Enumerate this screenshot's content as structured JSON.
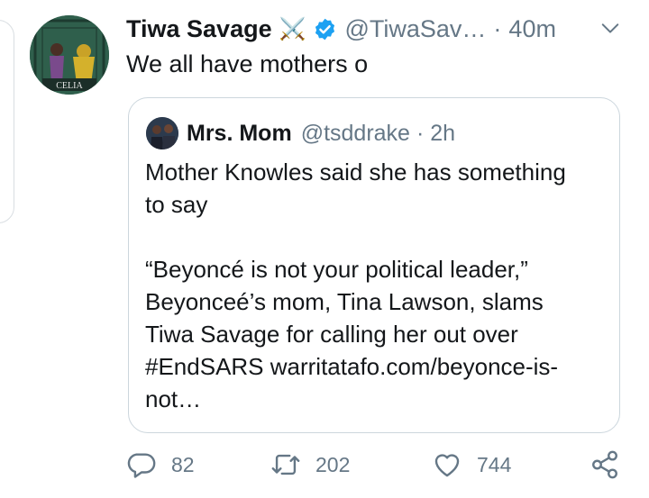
{
  "tweet": {
    "author_name": "Tiwa Savage",
    "author_emoji": "⚔️",
    "author_handle": "@TiwaSav…",
    "time": "40m",
    "text": "We all have mothers o",
    "avatar_caption": "CELIA"
  },
  "quoted": {
    "author_name": "Mrs. Mom",
    "author_handle": "@tsddrake",
    "time": "2h",
    "line1": "Mother Knowles said she has something",
    "line2": "to say",
    "line3": "“Beyoncé is not your political leader,”",
    "line4": "Beyonceé’s mom, Tina Lawson, slams",
    "line5": "Tiwa Savage for calling her out over",
    "line6": "#EndSARS warritatafo.com/beyonce-is-",
    "line7": "not…"
  },
  "actions": {
    "replies": "82",
    "retweets": "202",
    "likes": "744"
  },
  "colors": {
    "text": "#14171a",
    "secondary": "#657786",
    "border": "#ccd6dd",
    "verified": "#1da1f2"
  }
}
